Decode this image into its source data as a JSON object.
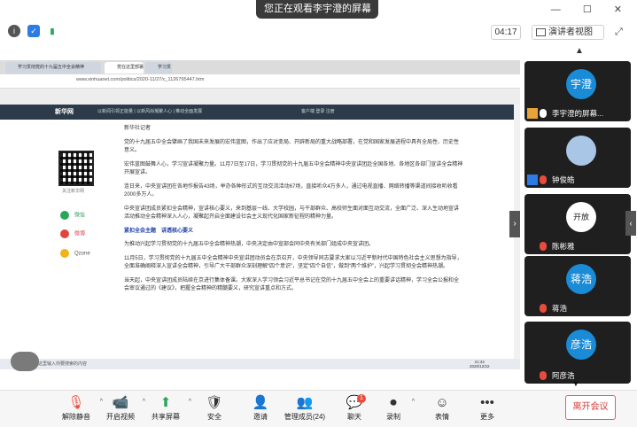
{
  "topbar": {
    "viewing_banner": "您正在观看李宇澄的屏幕",
    "chevron": "⌄",
    "window_controls": "— ☐ ✕"
  },
  "meeting_bar": {
    "timer": "04:17",
    "view_label": "演讲者视图"
  },
  "browser": {
    "tabs": [
      "学习贯彻党的十九届五中全会精神",
      "党在这里部署动人心",
      "学习贯彻党"
    ],
    "address": "www.xinhuanet.com/politics/2020-11/27/c_1126795447.htm",
    "site_logo": "新华网",
    "site_nav": "以新闻引领正能量 | 以新风尚凝聚人心 | 推动全面发展",
    "site_right": "客户端  登录  注册",
    "qr_caption": "关注新华网",
    "share": [
      "微信",
      "微博",
      "Qzone"
    ],
    "article": [
      "新华社记者",
      "党的十九届五中全会擘画了我国未来发展的宏伟蓝图，作出了应对变局、开辟新局的重大战略部署，在党和国家发展进程中具有全局性、历史性意义。",
      "宏伟蓝图鼓舞人心，学习宣讲凝聚力量。11月7日至17日，学习贯彻党的十九届五中全会精神中央宣讲团赴全国各地、各地区各部门宣讲全会精神开展宣讲。",
      "连日来，中央宣讲团在各地作报告43场，举办各种形式的互动交流活动67场，直接听众4万多人，通过电视直播、网络转播等渠道间接收听收看2000多万人。",
      "中央宣讲团成员紧扣全会精神，宣讲核心要义，来到基层一线、大学校园，与干部群众、高校师生面对面互动交流，全面广泛、深入生动地宣讲活动推动全会精神深入人心，凝聚起开启全面建设社会主义现代化国家新征程的精神力量。",
      "紧扣全会主题　讲透核心要义",
      "为推动兴起学习贯彻党的十九届五中全会精神热潮，中央决定由中宣部会同中央有关部门组成中央宣讲团。",
      "11月5日，学习贯彻党的十九届五中全会精神中央宣讲团动员会在京召开，中央领导同志要求大家以习近平新时代中国特色社会主义思想为指导，全面准确阐释深入宣讲全会精神，引导广大干部群众深刻理解“四个意识”，坚定“四个自信”，做到“两个维护”，兴起学习贯彻全会精神热潮。",
      "当天起，中央宣讲团成员陆续在京进行集体备课。大家深入学习领会习近平总书记在党的十九届五中全会上的重要讲话精神，学习全会公报和全会审议通过的《建议》，把握全会精神的精髓要义，研究宣讲重点和方式。"
    ],
    "taskbar_search": "在这里输入你要搜索的内容",
    "taskbar_time": "21:32",
    "taskbar_date": "2020/12/22"
  },
  "participants": [
    {
      "avatar_text": "宇澄",
      "name": "李宇澄的屏幕..."
    },
    {
      "avatar_text": "",
      "name": "钟俊皓"
    },
    {
      "avatar_text": "开放",
      "name": "陈彬雅"
    },
    {
      "avatar_text": "蒋浩",
      "name": "蒋浩"
    },
    {
      "avatar_text": "彦浩",
      "name": "阿彦浩"
    }
  ],
  "toolbar": {
    "unmute": "解除静音",
    "start_video": "开启视频",
    "share_screen": "共享屏幕",
    "security": "安全",
    "invite": "邀请",
    "manage_members": "管理成员(24)",
    "chat": "聊天",
    "chat_badge": "1",
    "record": "录制",
    "reactions": "表情",
    "more": "更多",
    "leave": "离开会议"
  },
  "colors": {
    "avatar_blue": "#1a8bd6",
    "leave_red": "#d93a3a",
    "mic_muted": "#e74c3c"
  }
}
